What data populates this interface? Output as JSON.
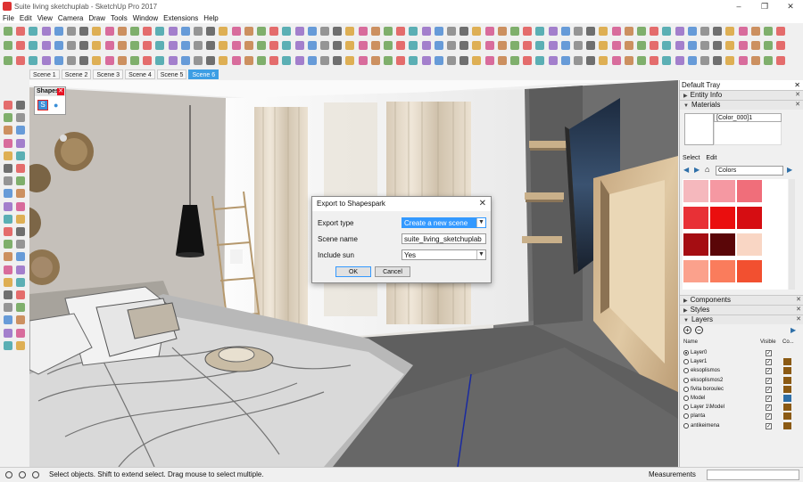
{
  "window": {
    "title": "Suite living sketchuplab - SketchUp Pro 2017"
  },
  "menu": [
    "File",
    "Edit",
    "View",
    "Camera",
    "Draw",
    "Tools",
    "Window",
    "Extensions",
    "Help"
  ],
  "scenes": {
    "tabs": [
      "Scene 1",
      "Scene 2",
      "Scene 3",
      "Scene 4",
      "Scene 5",
      "Scene 6"
    ],
    "active": "Scene 6"
  },
  "shapespark_panel": {
    "title": "Shapes..."
  },
  "dialog": {
    "title": "Export to Shapespark",
    "close": "✕",
    "export_type_label": "Export type",
    "export_type_value": "Create a new scene",
    "scene_name_label": "Scene name",
    "scene_name_value": "suite_living_sketchuplab",
    "include_sun_label": "Include sun",
    "include_sun_value": "Yes",
    "ok": "OK",
    "cancel": "Cancel"
  },
  "tray": {
    "title": "Default Tray",
    "sections": {
      "entity_info": "Entity Info",
      "materials": "Materials",
      "components": "Components",
      "styles": "Styles",
      "layers": "Layers"
    },
    "material_name": "[Color_000]1",
    "tab_select": "Select",
    "tab_edit": "Edit",
    "library": "Colors",
    "swatch_colors": [
      "#f5b8bd",
      "#f598a2",
      "#f06e7a",
      "#e83036",
      "#ea0e0e",
      "#d60d12",
      "#a50d12",
      "#5a0608",
      "#f9d6c4",
      "#fba18c",
      "#fa7c5c",
      "#f25030"
    ],
    "layers_columns": {
      "name": "Name",
      "visible": "Visible",
      "color": "Co..."
    },
    "layers": [
      {
        "name": "Layer0",
        "active": true,
        "color": ""
      },
      {
        "name": "Layer1",
        "active": false,
        "color": "#8b5a14"
      },
      {
        "name": "eksoplismos",
        "active": false,
        "color": "#8b5a14"
      },
      {
        "name": "eksoplismos2",
        "active": false,
        "color": "#8b5a14"
      },
      {
        "name": "fivita boroulec",
        "active": false,
        "color": "#8b5a14"
      },
      {
        "name": "Model",
        "active": false,
        "color": "#2e6fa8"
      },
      {
        "name": "Layer 1\\Model",
        "active": false,
        "color": "#8b5a14"
      },
      {
        "name": "planta",
        "active": false,
        "color": "#8b5a14"
      },
      {
        "name": "antikeimena",
        "active": false,
        "color": "#8b5a14"
      }
    ]
  },
  "status": {
    "message": "Select objects. Shift to extend select. Drag mouse to select multiple.",
    "measurements_label": "Measurements"
  }
}
